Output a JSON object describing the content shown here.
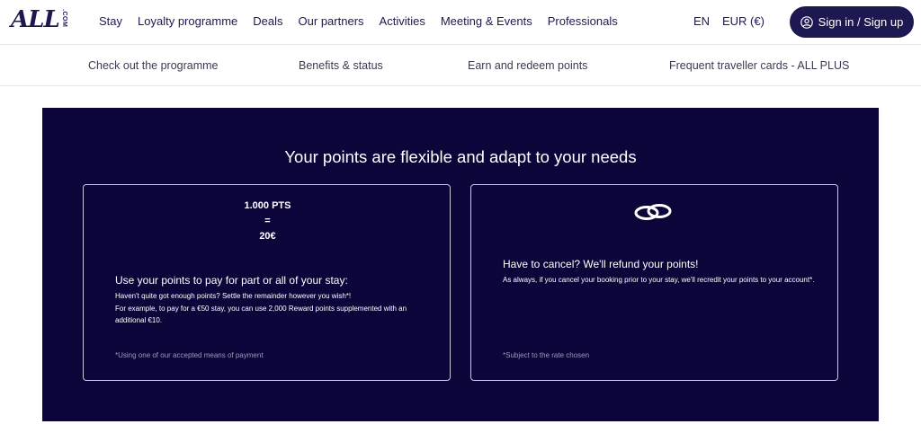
{
  "header": {
    "logo": "ALL",
    "logo_suffix": ".COM",
    "nav": [
      "Stay",
      "Loyalty programme",
      "Deals",
      "Our partners",
      "Activities",
      "Meeting & Events",
      "Professionals"
    ],
    "language": "EN",
    "currency": "EUR (€)",
    "signin_label": "Sign in / Sign up"
  },
  "subnav": {
    "items": [
      "Check out the programme",
      "Benefits & status",
      "Earn and redeem points",
      "Frequent traveller cards - ALL PLUS"
    ]
  },
  "panel": {
    "title": "Your points are flexible and adapt to your needs",
    "cards": [
      {
        "pts_line1": "1.000 PTS",
        "pts_line2": "=",
        "pts_line3": "20€",
        "heading": "Use your points to pay for part or all of your stay:",
        "text_line1": "Haven't quite got enough points? Settle the remainder however you wish*!",
        "text_line2": "For example, to pay for a €50 stay, you can use 2,000 Reward points supplemented with an additional €10.",
        "footnote": "*Using one of our accepted means of payment"
      },
      {
        "icon": "rings-icon",
        "heading": "Have to cancel? We'll refund your points!",
        "text": "As always, if you cancel your booking prior to your stay, we'll recredit your points to your account*.",
        "footnote": "*Subject to the rate chosen"
      }
    ]
  },
  "colors": {
    "brand_navy": "#1e1852",
    "panel_bg": "#0c0539"
  }
}
